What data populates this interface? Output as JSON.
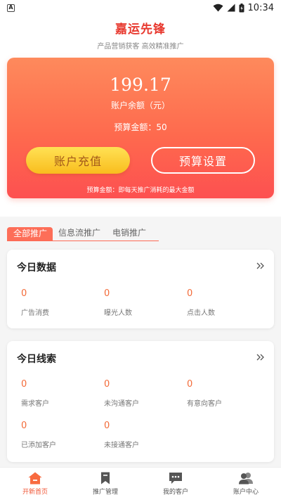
{
  "status_bar": {
    "notification_icon": "A",
    "time": "10:34"
  },
  "header": {
    "title": "嘉运先锋",
    "subtitle": "产品营销获客 高效精准推广"
  },
  "balance_card": {
    "amount": "199.17",
    "amount_label": "账户余额（元）",
    "budget_line": "预算金额：50",
    "recharge_button": "账户充值",
    "budget_button": "预算设置",
    "note": "预算金额：即每天推广消耗的最大金额"
  },
  "tabs": [
    {
      "label": "全部推广",
      "active": true
    },
    {
      "label": "信息流推广",
      "active": false
    },
    {
      "label": "电销推广",
      "active": false
    }
  ],
  "today_data": {
    "title": "今日数据",
    "stats": [
      {
        "value": "0",
        "label": "广告消费"
      },
      {
        "value": "0",
        "label": "曝光人数"
      },
      {
        "value": "0",
        "label": "点击人数"
      }
    ]
  },
  "today_leads": {
    "title": "今日线索",
    "stats": [
      {
        "value": "0",
        "label": "需求客户"
      },
      {
        "value": "0",
        "label": "未沟通客户"
      },
      {
        "value": "0",
        "label": "有意向客户"
      },
      {
        "value": "0",
        "label": "已添加客户"
      },
      {
        "value": "0",
        "label": "未接通客户"
      }
    ]
  },
  "bottom_nav": [
    {
      "label": "开新首页",
      "icon": "home-icon",
      "active": true
    },
    {
      "label": "推广管理",
      "icon": "bookmark-icon",
      "active": false
    },
    {
      "label": "我的客户",
      "icon": "chat-icon",
      "active": false
    },
    {
      "label": "账户中心",
      "icon": "users-icon",
      "active": false
    }
  ],
  "colors": {
    "accent": "#e8382e",
    "active_nav": "#f05535",
    "stat_value": "#f36c3a"
  }
}
